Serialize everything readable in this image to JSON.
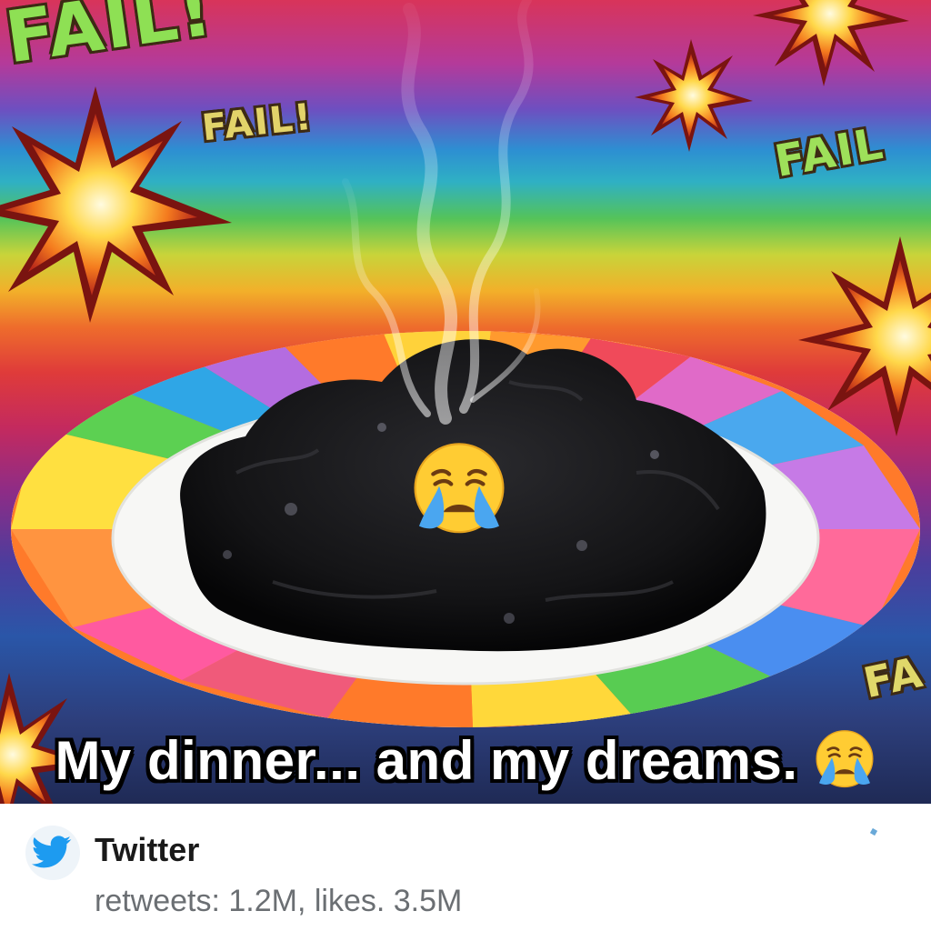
{
  "image": {
    "fail_labels": [
      "FAIL!",
      "FAIL!",
      "FAIL",
      "FA"
    ],
    "caption": "My dinner... and my dreams.",
    "emoji": [
      "loudly-crying-face",
      "loudly-crying-face"
    ]
  },
  "tweet": {
    "account_name": "Twitter",
    "stats": "retweets: 1.2M, likes. 3.5M",
    "icon": "twitter-bird-icon"
  },
  "colors": {
    "fail_green": "#8ee054",
    "caption_text": "#ffffff",
    "twitter_blue": "#1d9bf0",
    "stats_gray": "#6b6f73"
  }
}
